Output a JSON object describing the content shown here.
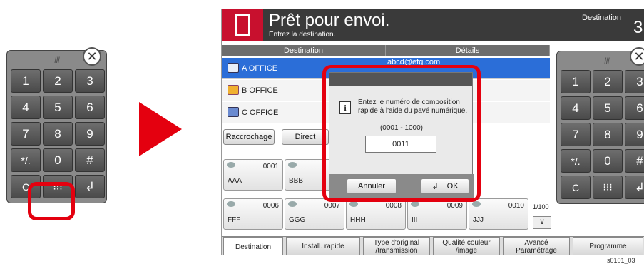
{
  "keypad": {
    "handle_label": "III",
    "close_icon": "close-icon",
    "keys": [
      "1",
      "2",
      "3",
      "4",
      "5",
      "6",
      "7",
      "8",
      "9",
      "*/.",
      "0",
      "#",
      "C",
      "⁝⁝⁝",
      "↲"
    ]
  },
  "arrow_color": "#e4000f",
  "highlight_color": "#e4000f",
  "header": {
    "title": "Prêt pour envoi.",
    "subtitle": "Entrez la destination.",
    "destination_label": "Destination",
    "destination_count": "3"
  },
  "list": {
    "columns": [
      "Destination",
      "Détails"
    ],
    "rows": [
      {
        "name": "A OFFICE",
        "detail": "abcd@efg.com",
        "icon": "email-icon",
        "selected": true
      },
      {
        "name": "B OFFICE",
        "detail": "",
        "icon": "folder-icon",
        "selected": false
      },
      {
        "name": "C OFFICE",
        "detail": "",
        "icon": "fax-icon",
        "selected": false
      }
    ]
  },
  "buttons": {
    "raccrochage": "Raccrochage",
    "direct": "Direct"
  },
  "tiles_row1": [
    {
      "num": "0001",
      "name": "AAA"
    },
    {
      "num": "",
      "name": "BBB"
    }
  ],
  "tiles_row2": [
    {
      "num": "0006",
      "name": "FFF"
    },
    {
      "num": "0007",
      "name": "GGG"
    },
    {
      "num": "0008",
      "name": "HHH"
    },
    {
      "num": "0009",
      "name": "III"
    },
    {
      "num": "0010",
      "name": "JJJ"
    }
  ],
  "page_indicator": "1/100",
  "dialog": {
    "message": "Entez le numéro de composition rapide à l'aide du pavé numérique.",
    "range": "(0001 - 1000)",
    "value": "0011",
    "cancel_label": "Annuler",
    "ok_label": "OK"
  },
  "tabs": [
    "Destination",
    "Install. rapide",
    "Type d'original /transmission",
    "Qualité couleur /image",
    "Avancé Paramétrage",
    "Programme"
  ],
  "image_code": "s0101_03"
}
